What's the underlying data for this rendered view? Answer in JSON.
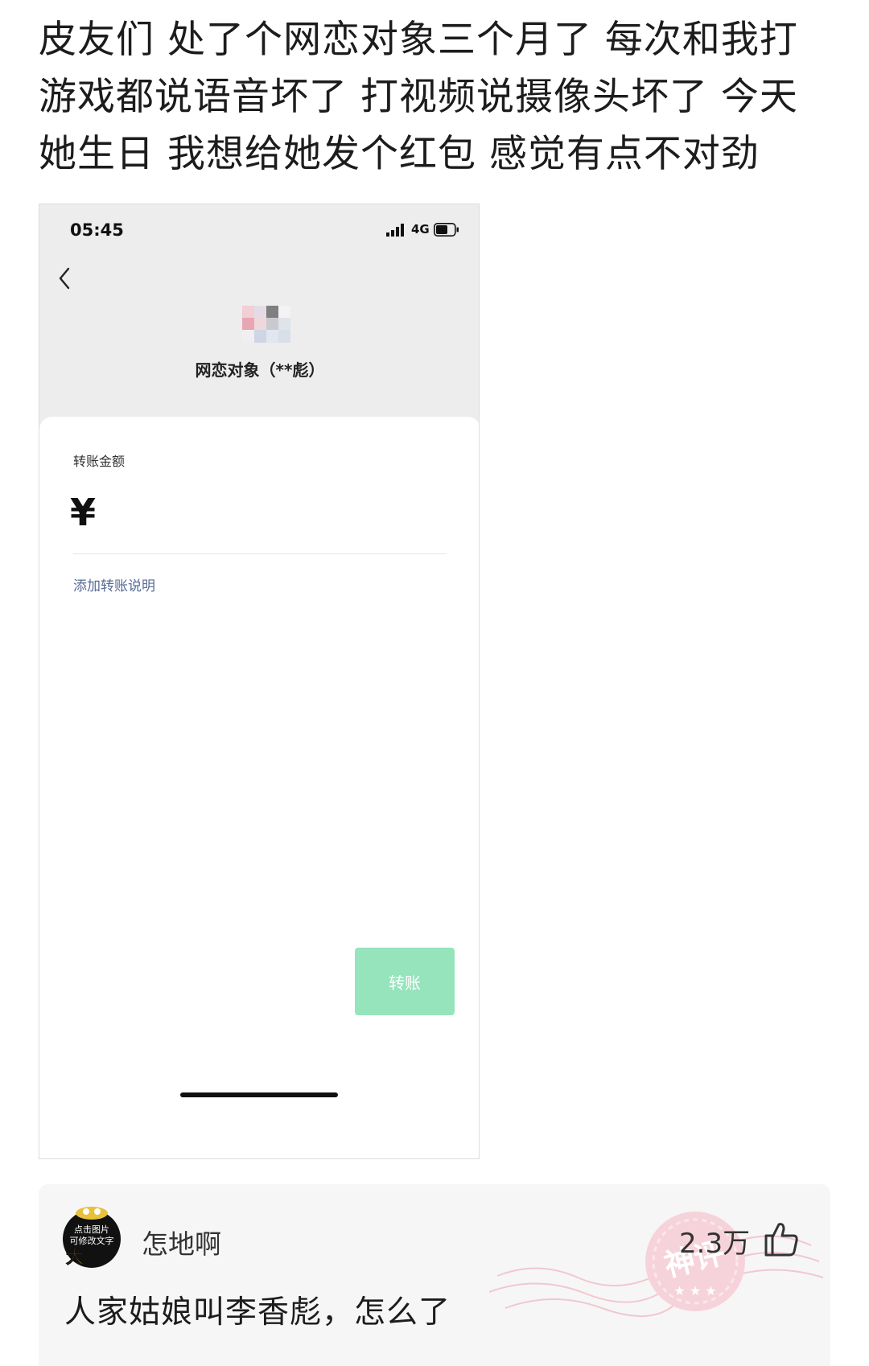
{
  "post": {
    "text": "皮友们 处了个网恋对象三个月了 每次和我打游戏都说语音坏了 打视频说摄像头坏了 今天她生日 我想给她发个红包 感觉有点不对劲"
  },
  "screenshot": {
    "status_bar": {
      "time": "05:45",
      "network": "4G"
    },
    "recipient_name": "网恋对象（**彪）",
    "amount_label": "转账金额",
    "currency_symbol": "¥",
    "add_note_link": "添加转账说明",
    "transfer_button": "转账",
    "colors": {
      "link": "#576b95",
      "button_disabled": "#95e4bb",
      "background": "#ededed"
    }
  },
  "comment": {
    "avatar_text": [
      "点击图片",
      "可修改文字"
    ],
    "avatar_badge": "大神",
    "username": "怎地啊",
    "likes": "2.3万",
    "text": "人家姑娘叫李香彪，怎么了",
    "stamp_text": "神评",
    "icons": [
      "like-icon",
      "avatar-icon"
    ]
  }
}
